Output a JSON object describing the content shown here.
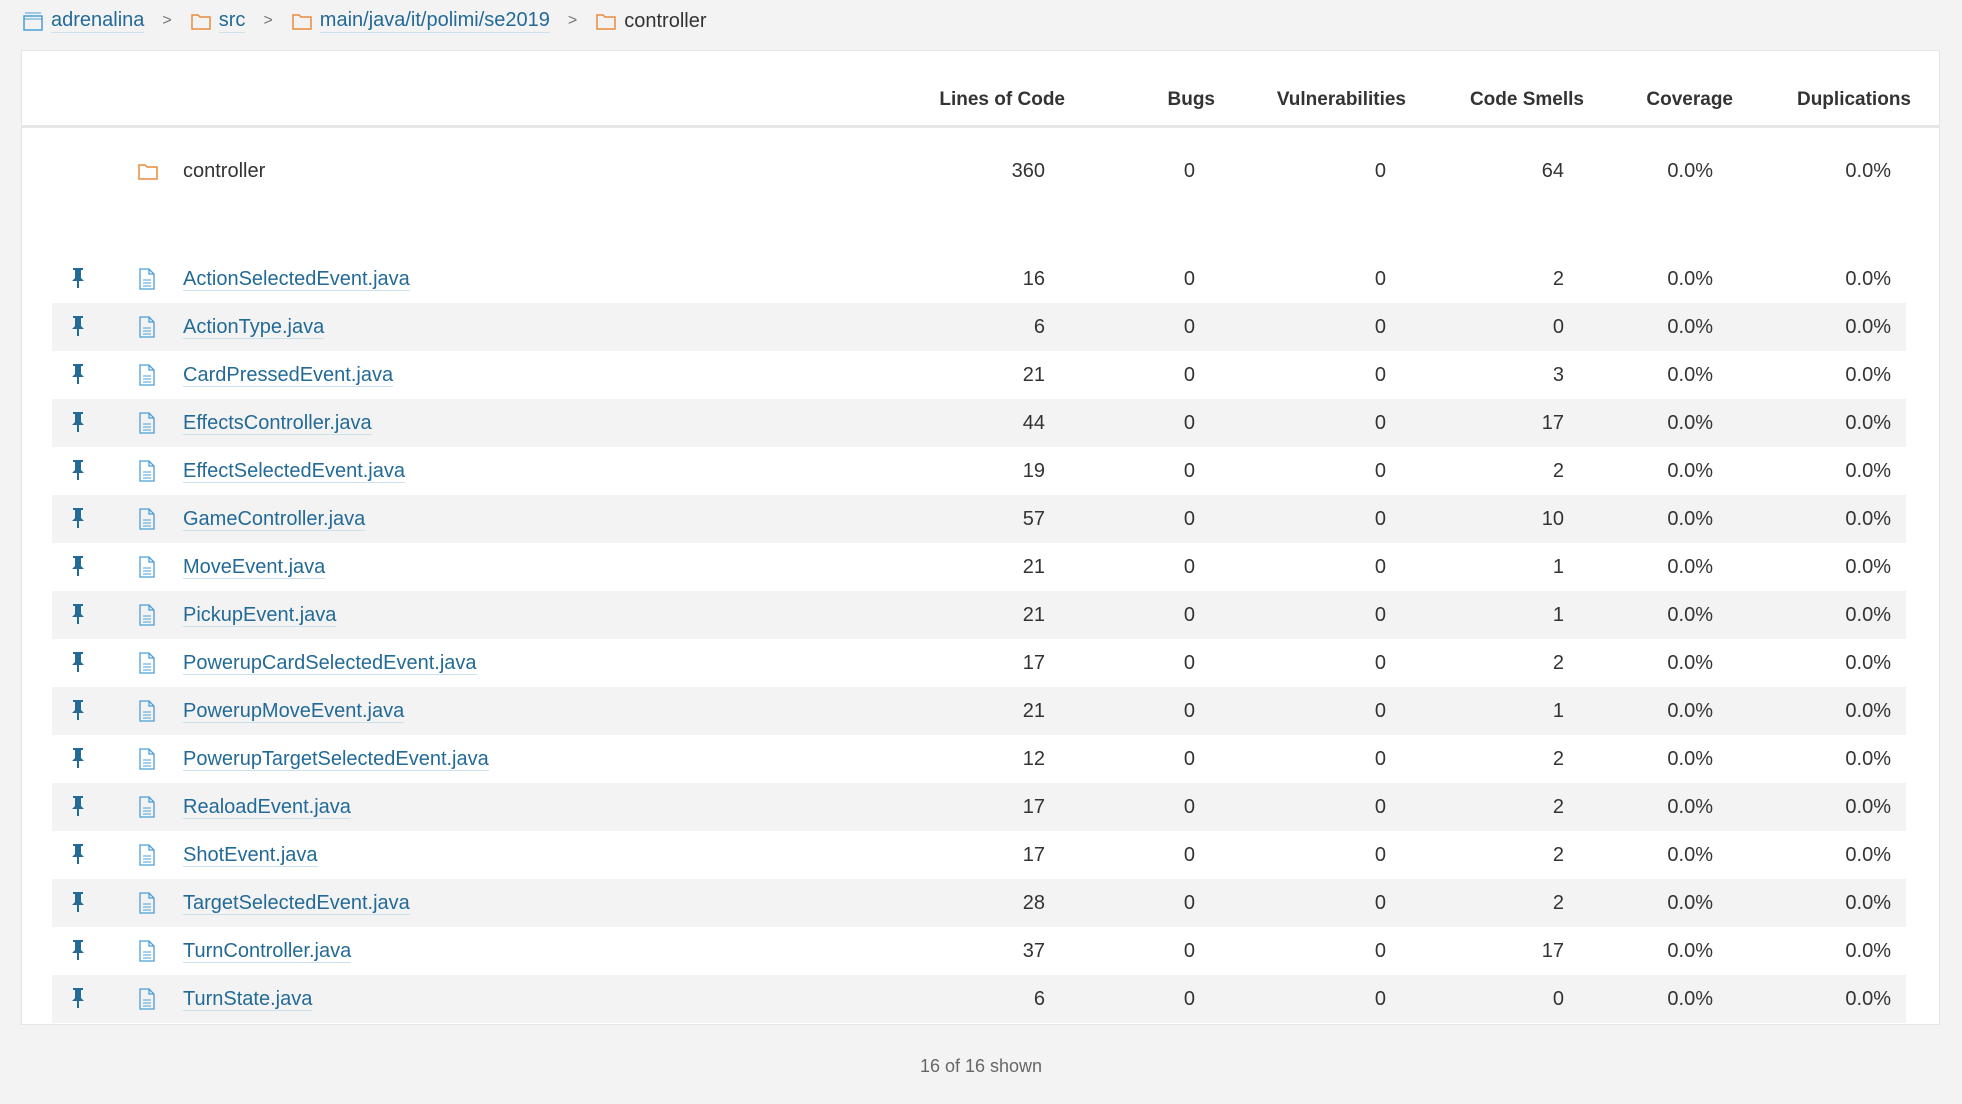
{
  "breadcrumb": [
    {
      "label": "adrenalina",
      "icon": "project-icon"
    },
    {
      "label": "src",
      "icon": "folder-icon"
    },
    {
      "label": "main/java/it/polimi/se2019",
      "icon": "folder-icon"
    },
    {
      "label": "controller",
      "icon": "folder-icon"
    }
  ],
  "columns": [
    "Lines of Code",
    "Bugs",
    "Vulnerabilities",
    "Code Smells",
    "Coverage",
    "Duplications"
  ],
  "folder": {
    "name": "controller",
    "loc": "360",
    "bugs": "0",
    "vuln": "0",
    "smells": "64",
    "coverage": "0.0%",
    "dup": "0.0%"
  },
  "files": [
    {
      "name": "ActionSelectedEvent.java",
      "loc": "16",
      "bugs": "0",
      "vuln": "0",
      "smells": "2",
      "coverage": "0.0%",
      "dup": "0.0%"
    },
    {
      "name": "ActionType.java",
      "loc": "6",
      "bugs": "0",
      "vuln": "0",
      "smells": "0",
      "coverage": "0.0%",
      "dup": "0.0%"
    },
    {
      "name": "CardPressedEvent.java",
      "loc": "21",
      "bugs": "0",
      "vuln": "0",
      "smells": "3",
      "coverage": "0.0%",
      "dup": "0.0%"
    },
    {
      "name": "EffectsController.java",
      "loc": "44",
      "bugs": "0",
      "vuln": "0",
      "smells": "17",
      "coverage": "0.0%",
      "dup": "0.0%"
    },
    {
      "name": "EffectSelectedEvent.java",
      "loc": "19",
      "bugs": "0",
      "vuln": "0",
      "smells": "2",
      "coverage": "0.0%",
      "dup": "0.0%"
    },
    {
      "name": "GameController.java",
      "loc": "57",
      "bugs": "0",
      "vuln": "0",
      "smells": "10",
      "coverage": "0.0%",
      "dup": "0.0%"
    },
    {
      "name": "MoveEvent.java",
      "loc": "21",
      "bugs": "0",
      "vuln": "0",
      "smells": "1",
      "coverage": "0.0%",
      "dup": "0.0%"
    },
    {
      "name": "PickupEvent.java",
      "loc": "21",
      "bugs": "0",
      "vuln": "0",
      "smells": "1",
      "coverage": "0.0%",
      "dup": "0.0%"
    },
    {
      "name": "PowerupCardSelectedEvent.java",
      "loc": "17",
      "bugs": "0",
      "vuln": "0",
      "smells": "2",
      "coverage": "0.0%",
      "dup": "0.0%"
    },
    {
      "name": "PowerupMoveEvent.java",
      "loc": "21",
      "bugs": "0",
      "vuln": "0",
      "smells": "1",
      "coverage": "0.0%",
      "dup": "0.0%"
    },
    {
      "name": "PowerupTargetSelectedEvent.java",
      "loc": "12",
      "bugs": "0",
      "vuln": "0",
      "smells": "2",
      "coverage": "0.0%",
      "dup": "0.0%"
    },
    {
      "name": "RealoadEvent.java",
      "loc": "17",
      "bugs": "0",
      "vuln": "0",
      "smells": "2",
      "coverage": "0.0%",
      "dup": "0.0%"
    },
    {
      "name": "ShotEvent.java",
      "loc": "17",
      "bugs": "0",
      "vuln": "0",
      "smells": "2",
      "coverage": "0.0%",
      "dup": "0.0%"
    },
    {
      "name": "TargetSelectedEvent.java",
      "loc": "28",
      "bugs": "0",
      "vuln": "0",
      "smells": "2",
      "coverage": "0.0%",
      "dup": "0.0%"
    },
    {
      "name": "TurnController.java",
      "loc": "37",
      "bugs": "0",
      "vuln": "0",
      "smells": "17",
      "coverage": "0.0%",
      "dup": "0.0%"
    },
    {
      "name": "TurnState.java",
      "loc": "6",
      "bugs": "0",
      "vuln": "0",
      "smells": "0",
      "coverage": "0.0%",
      "dup": "0.0%"
    }
  ],
  "footer": "16 of 16 shown",
  "colors": {
    "link": "#236a97",
    "folder": "#e98b3c",
    "pin": "#236a97"
  }
}
